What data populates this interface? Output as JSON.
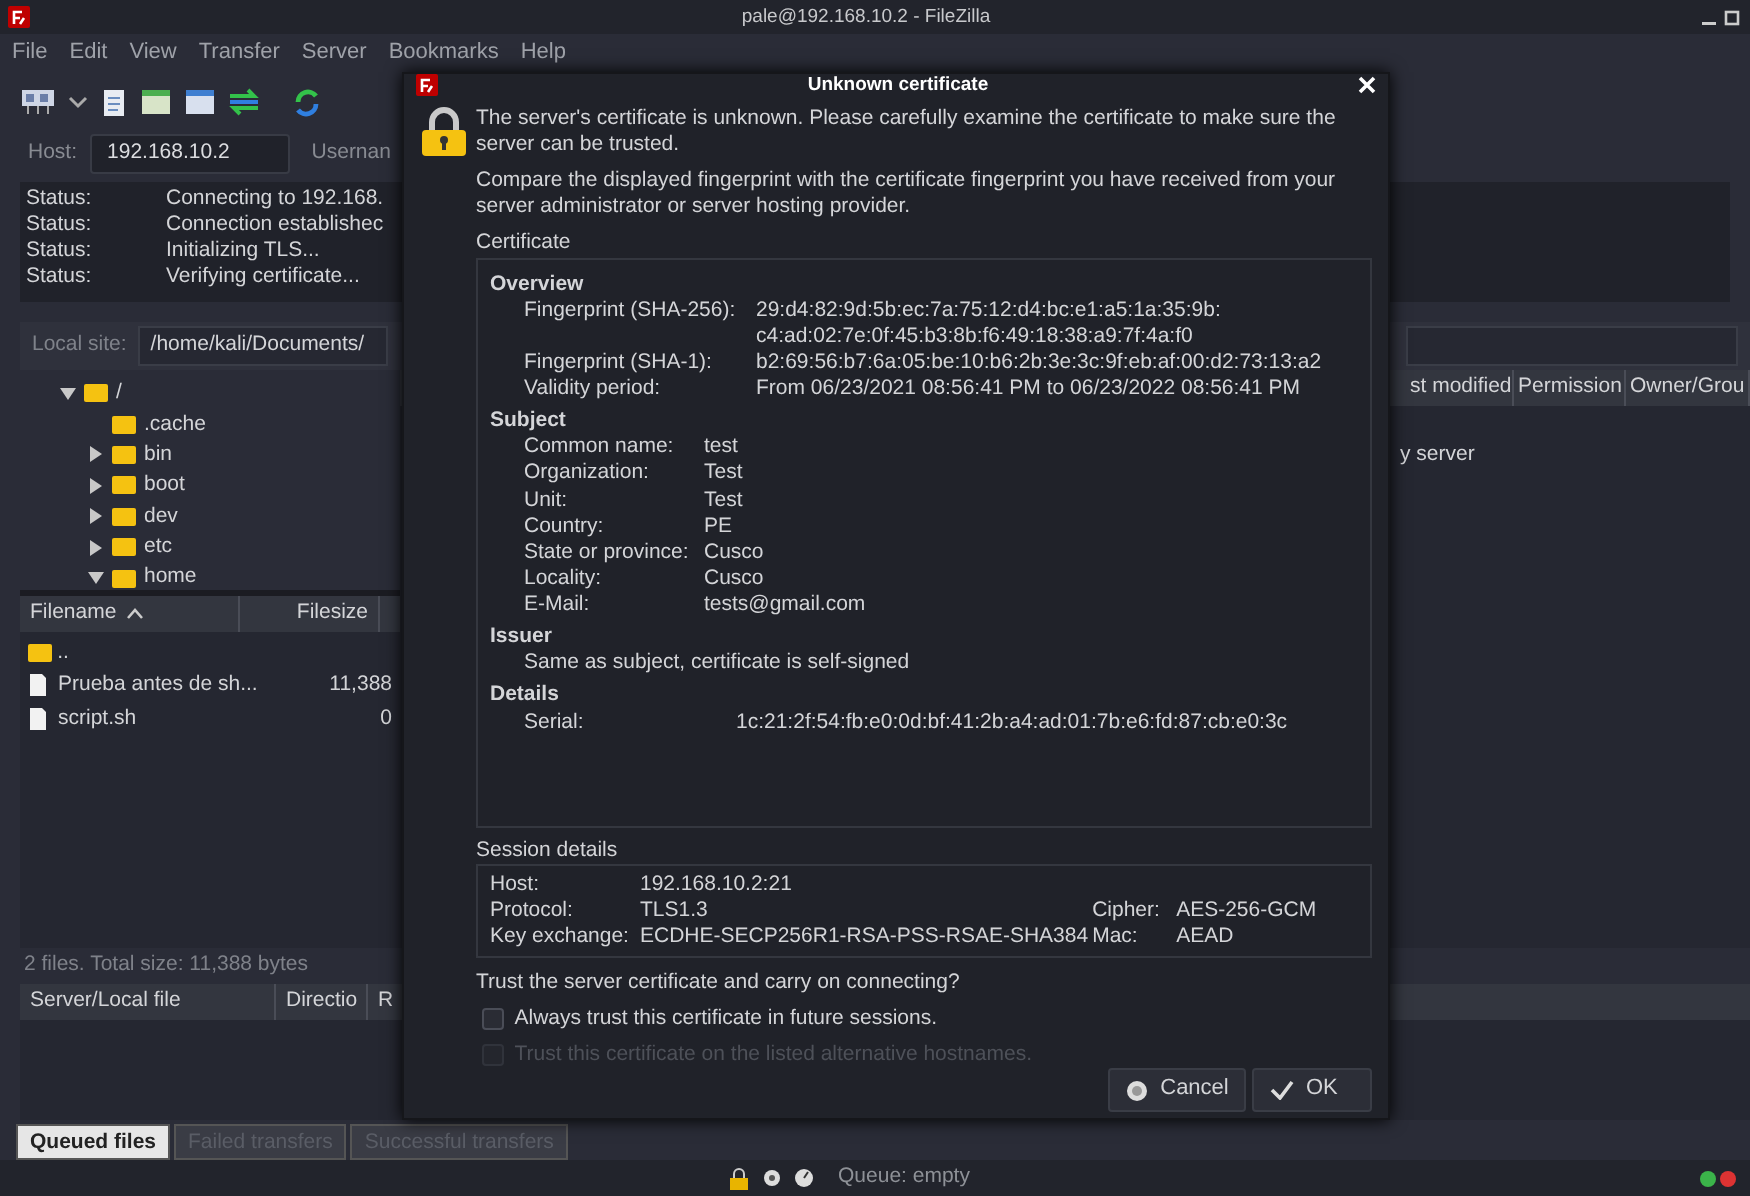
{
  "window": {
    "title": "pale@192.168.10.2 - FileZilla"
  },
  "menu": [
    "File",
    "Edit",
    "View",
    "Transfer",
    "Server",
    "Bookmarks",
    "Help"
  ],
  "quickconnect": {
    "host_label": "Host:",
    "host_value": "192.168.10.2",
    "username_label": "Usernan"
  },
  "log": [
    {
      "label": "Status:",
      "message": "Connecting to 192.168."
    },
    {
      "label": "Status:",
      "message": "Connection establishec"
    },
    {
      "label": "Status:",
      "message": "Initializing TLS..."
    },
    {
      "label": "Status:",
      "message": "Verifying certificate..."
    }
  ],
  "local_site": {
    "label": "Local site:",
    "path": "/home/kali/Documents/"
  },
  "tree": [
    {
      "name": "/",
      "kind": "branch",
      "expanded": true,
      "children": [
        {
          "name": ".cache",
          "kind": "leaf"
        },
        {
          "name": "bin",
          "kind": "branch",
          "expanded": false
        },
        {
          "name": "boot",
          "kind": "branch",
          "expanded": false
        },
        {
          "name": "dev",
          "kind": "branch",
          "expanded": false
        },
        {
          "name": "etc",
          "kind": "branch",
          "expanded": false
        },
        {
          "name": "home",
          "kind": "branch",
          "expanded": true
        }
      ]
    }
  ],
  "local_files": {
    "columns": [
      {
        "label": "Filename",
        "sorted": true
      },
      {
        "label": "Filesize",
        "sorted": false
      }
    ],
    "rows": [
      {
        "kind": "folder",
        "name": ".."
      },
      {
        "kind": "file",
        "name": "Prueba antes de sh...",
        "size": "11,388"
      },
      {
        "kind": "file",
        "name": "script.sh",
        "size": "0"
      }
    ],
    "status": "2 files. Total size: 11,388 bytes"
  },
  "remote_files": {
    "columns": [
      "st modified",
      "Permission",
      "Owner/Grou"
    ],
    "message": "y server"
  },
  "queue": {
    "columns": [
      "Server/Local file",
      "Directio",
      "R"
    ]
  },
  "queue_tabs": [
    {
      "label": "Queued files",
      "selected": true
    },
    {
      "label": "Failed transfers",
      "selected": false
    },
    {
      "label": "Successful transfers",
      "selected": false
    }
  ],
  "status_bar": {
    "queue": "Queue: empty"
  },
  "dialog": {
    "title": "Unknown certificate",
    "intro": [
      "The server's certificate is unknown. Please carefully examine the certificate to make sure the server can be trusted.",
      "Compare the displayed fingerprint with the certificate fingerprint you have received from your server administrator or server hosting provider."
    ],
    "certificate_label": "Certificate",
    "sections": [
      {
        "heading": "Overview",
        "fields": [
          {
            "label": "Fingerprint (SHA-256):",
            "value_lines": [
              "29:d4:82:9d:5b:ec:7a:75:12:d4:bc:e1:a5:1a:35:9b:",
              "c4:ad:02:7e:0f:45:b3:8b:f6:49:18:38:a9:7f:4a:f0"
            ]
          },
          {
            "label": "Fingerprint (SHA-1):",
            "value_lines": [
              "b2:69:56:b7:6a:05:be:10:b6:2b:3e:3c:9f:eb:af:00:d2:73:13:a2"
            ]
          },
          {
            "label": "Validity period:",
            "value_lines": [
              "From 06/23/2021 08:56:41 PM to 06/23/2022 08:56:41 PM"
            ]
          }
        ]
      },
      {
        "heading": "Subject",
        "fields": [
          {
            "label": "Common name:",
            "value_lines": [
              "test"
            ]
          },
          {
            "label": "Organization:",
            "value_lines": [
              "Test"
            ]
          },
          {
            "label": "Unit:",
            "value_lines": [
              "Test"
            ]
          },
          {
            "label": "Country:",
            "value_lines": [
              "PE"
            ]
          },
          {
            "label": "State or province:",
            "value_lines": [
              "Cusco"
            ]
          },
          {
            "label": "Locality:",
            "value_lines": [
              "Cusco"
            ]
          },
          {
            "label": "E-Mail:",
            "value_lines": [
              "tests@gmail.com"
            ]
          }
        ]
      },
      {
        "heading": "Issuer",
        "note": "Same as subject, certificate is self-signed"
      },
      {
        "heading": "Details",
        "fields": [
          {
            "label": "Serial:",
            "value_lines": [
              "1c:21:2f:54:fb:e0:0d:bf:41:2b:a4:ad:01:7b:e6:fd:87:cb:e0:3c"
            ]
          }
        ]
      }
    ],
    "session_label": "Session details",
    "session": [
      {
        "label": "Host:",
        "value": "192.168.10.2:21"
      },
      {
        "label": "Protocol:",
        "value": "TLS1.3",
        "side_label": "Cipher:",
        "side_value": "AES-256-GCM"
      },
      {
        "label": "Key exchange:",
        "value": "ECDHE-SECP256R1-RSA-PSS-RSAE-SHA384",
        "side_label": "Mac:",
        "side_value": "AEAD"
      }
    ],
    "question": "Trust the server certificate and carry on connecting?",
    "options": [
      {
        "label": "Always trust this certificate in future sessions.",
        "checked": false,
        "disabled": false
      },
      {
        "label": "Trust this certificate on the listed alternative hostnames.",
        "checked": false,
        "disabled": true
      }
    ],
    "buttons": [
      {
        "label": "Cancel",
        "kind": "cancel"
      },
      {
        "label": "OK",
        "kind": "ok"
      }
    ]
  }
}
